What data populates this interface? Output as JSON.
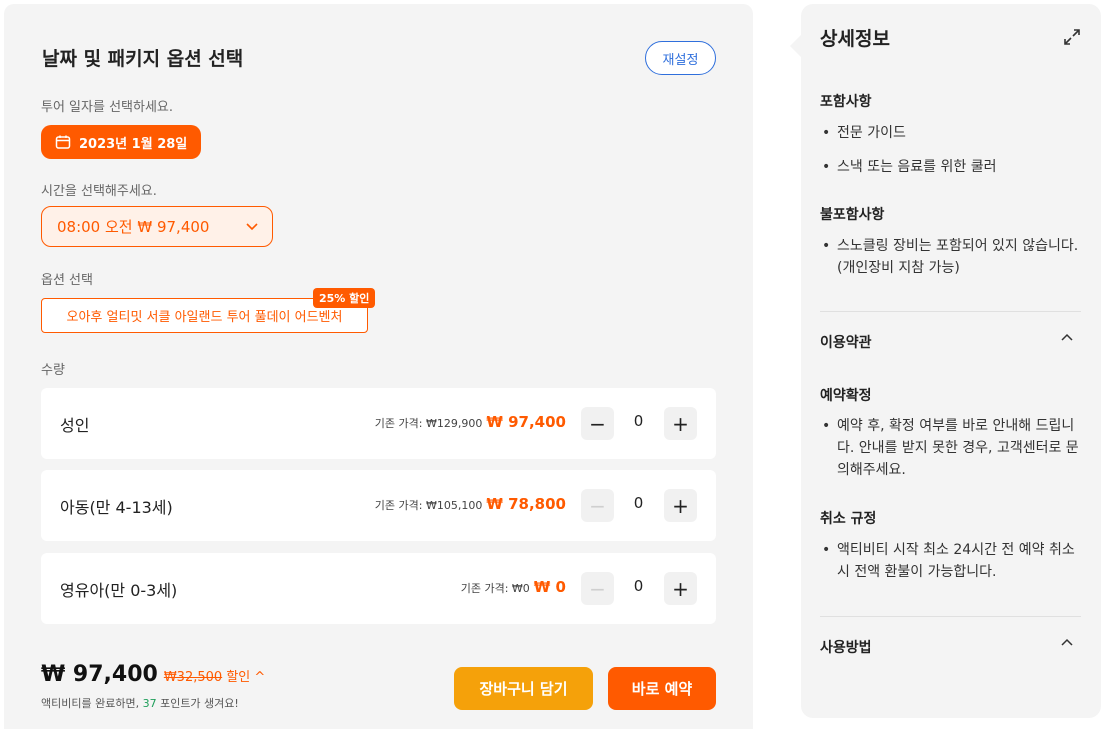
{
  "booking": {
    "title": "날짜 및 패키지 옵션 선택",
    "reset_label": "재설정",
    "date_prompt": "투어 일자를 선택하세요.",
    "date_value": "2023년 1월 28일",
    "time_prompt": "시간을 선택해주세요.",
    "time_value": "08:00 오전 ₩ 97,400",
    "option_prompt": "옵션 선택",
    "option_value": "오아후 얼티밋 서클 아일랜드 투어 풀데이 어드벤처",
    "option_badge": "25% 할인",
    "quantity_label": "수량",
    "rows": [
      {
        "name": "성인",
        "orig_label": "기존 가격: ₩129,900",
        "price": "₩ 97,400",
        "qty": "0",
        "minus": "−",
        "plus": "+"
      },
      {
        "name": "아동(만 4-13세)",
        "orig_label": "기존 가격: ₩105,100",
        "price": "₩ 78,800",
        "qty": "0",
        "minus": "−",
        "plus": "+"
      },
      {
        "name": "영유아(만 0-3세)",
        "orig_label": "기존 가격: ₩0",
        "price": "₩ 0",
        "qty": "0",
        "minus": "−",
        "plus": "+"
      }
    ],
    "total": "₩ 97,400",
    "total_discount_amount": "₩32,500",
    "total_discount_suffix": "할인",
    "total_discount_chevron": "^",
    "points_before": "액티비티를 완료하면, ",
    "points_value": "37",
    "points_after": " 포인트가 생겨요!",
    "cart_label": "장바구니 담기",
    "buy_label": "바로 예약"
  },
  "details": {
    "title": "상세정보",
    "included_title": "포함사항",
    "included": [
      "전문 가이드",
      "스낵 또는 음료를 위한 쿨러"
    ],
    "excluded_title": "불포함사항",
    "excluded": [
      "스노클링 장비는 포함되어 있지 않습니다. (개인장비 지참 가능)"
    ],
    "terms_title": "이용약관",
    "confirm_title": "예약확정",
    "confirm_items": [
      "예약 후, 확정 여부를 바로 안내해 드립니다. 안내를 받지 못한 경우, 고객센터로 문의해주세요."
    ],
    "cancel_title": "취소 규정",
    "cancel_items": [
      "액티비티 시작 최소 24시간 전 예약 취소시 전액 환불이 가능합니다."
    ],
    "usage_title": "사용방법"
  },
  "colors": {
    "accent": "#ff5a00",
    "cart": "#f5a10a",
    "link": "#2f6fdc",
    "points": "#1e9e5a"
  }
}
